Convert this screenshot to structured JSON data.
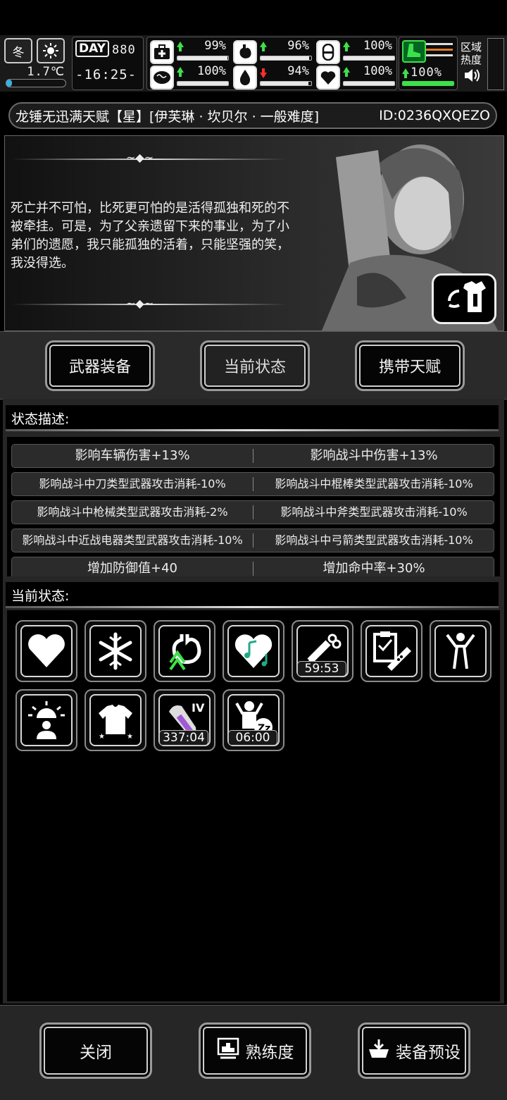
{
  "hud": {
    "season": "冬",
    "weather_icon": "sun-icon",
    "temperature": "1.7℃",
    "day_label": "DAY",
    "day": "880",
    "time": "-16:25-",
    "temp_progress": 0.1,
    "stats": [
      {
        "icon": "medkit-icon",
        "trend": "up",
        "value": "99%",
        "fill": 0.99
      },
      {
        "icon": "stomach-icon",
        "trend": "up",
        "value": "96%",
        "fill": 0.96
      },
      {
        "icon": "pill-icon",
        "trend": "up",
        "value": "100%",
        "fill": 1.0
      },
      {
        "icon": "brain-icon",
        "trend": "up",
        "value": "100%",
        "fill": 1.0
      },
      {
        "icon": "water-drop-icon",
        "trend": "down",
        "value": "94%",
        "fill": 0.94
      },
      {
        "icon": "heart-icon",
        "trend": "up",
        "value": "100%",
        "fill": 1.0
      }
    ],
    "stamina": {
      "icon": "boot-icon",
      "value": "100%",
      "fill": 1.0
    },
    "region_label": "区域热度",
    "sound_icon": "speaker-icon"
  },
  "title": {
    "text": "龙锤无迅满天赋【星】[伊芙琳 · 坎贝尔 · 一般难度]",
    "id": "ID:0236QXQEZO"
  },
  "portrait": {
    "quote": "死亡并不可怕，比死更可怕的是活得孤独和死的不被牵挂。可是，为了父亲遗留下来的事业，为了小弟们的遗愿，我只能孤独的活着，只能坚强的笑，我没得选。",
    "wardrobe_icon": "wardrobe-swap-icon"
  },
  "tabs": [
    {
      "label": "武器装备",
      "active": false
    },
    {
      "label": "当前状态",
      "active": true
    },
    {
      "label": "携带天赋",
      "active": false
    }
  ],
  "status_desc": {
    "header": "状态描述:",
    "rows": [
      [
        "影响车辆伤害+13%",
        "影响战斗中伤害+13%"
      ],
      [
        "影响战斗中刀类型武器攻击消耗-10%",
        "影响战斗中棍棒类型武器攻击消耗-10%"
      ],
      [
        "影响战斗中枪械类型武器攻击消耗-2%",
        "影响战斗中斧类型武器攻击消耗-10%"
      ],
      [
        "影响战斗中近战电器类型武器攻击消耗-10%",
        "影响战斗中弓箭类型武器攻击消耗-10%"
      ],
      [
        "增加防御值+40",
        "增加命中率+30%"
      ]
    ]
  },
  "current_status": {
    "header": "当前状态:",
    "icons": [
      {
        "name": "heart-status-icon",
        "timer": ""
      },
      {
        "name": "snowflake-status-icon",
        "timer": ""
      },
      {
        "name": "stomach-status-icon",
        "timer": ""
      },
      {
        "name": "music-heart-status-icon",
        "timer": ""
      },
      {
        "name": "syringe-status-icon",
        "timer": "59:53"
      },
      {
        "name": "medical-record-status-icon",
        "timer": ""
      },
      {
        "name": "fitness-status-icon",
        "timer": ""
      },
      {
        "name": "alarm-person-status-icon",
        "timer": ""
      },
      {
        "name": "clothing-status-icon",
        "timer": ""
      },
      {
        "name": "injury-arm-status-icon",
        "badge": "IV",
        "timer": "337:04"
      },
      {
        "name": "sleep-status-icon",
        "timer": "06:00"
      }
    ]
  },
  "bottom": {
    "close": "关闭",
    "proficiency": "熟练度",
    "equip_preset": "装备预设"
  }
}
